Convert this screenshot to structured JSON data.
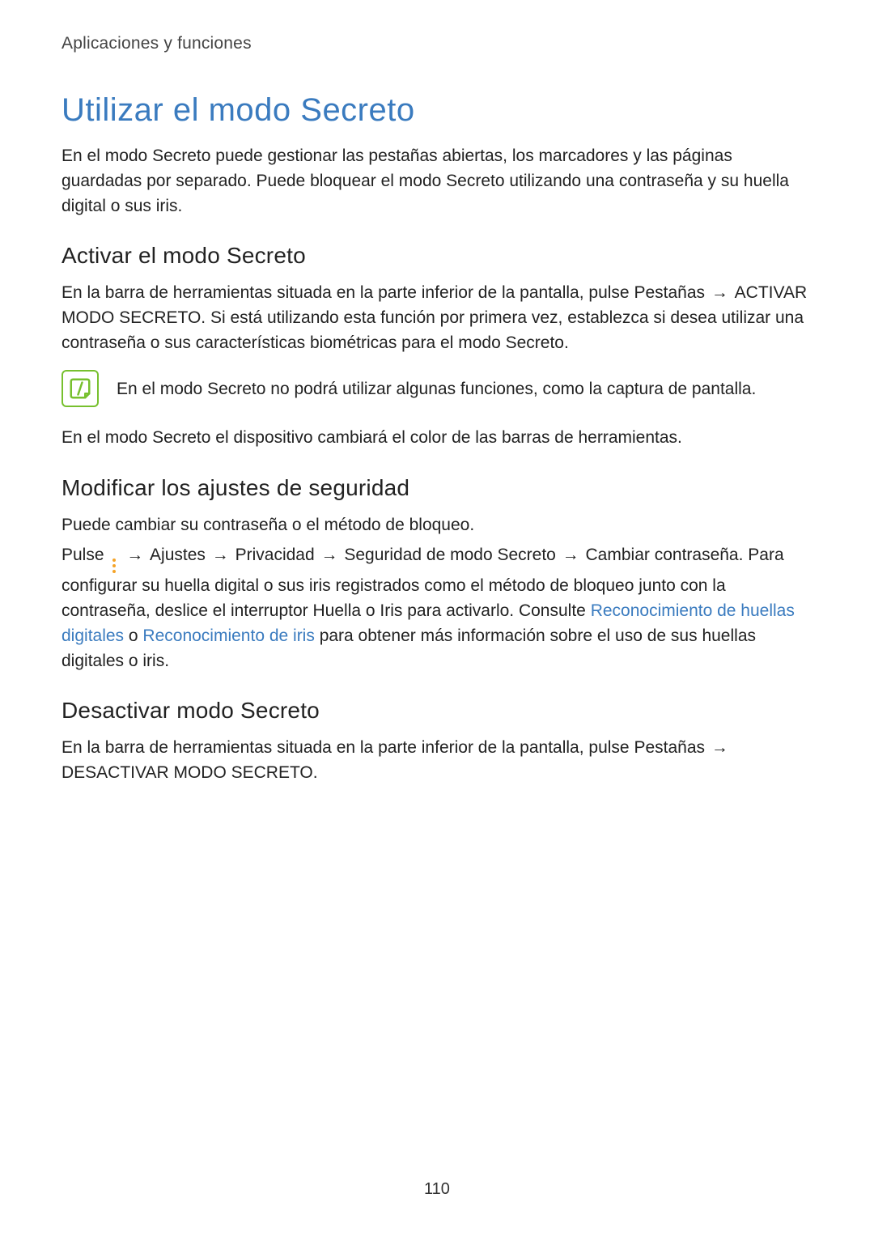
{
  "breadcrumb": "Aplicaciones y funciones",
  "title": "Utilizar el modo Secreto",
  "intro": "En el modo Secreto puede gestionar las pestañas abiertas, los marcadores y las páginas guardadas por separado. Puede bloquear el modo Secreto utilizando una contraseña y su huella digital o sus iris.",
  "sec1": {
    "heading": "Activar el modo Secreto",
    "p1_a": "En la barra de herramientas situada en la parte inferior de la pantalla, pulse ",
    "ui_tabs": "Pestañas",
    "arrow": " → ",
    "ui_activate": "ACTIVAR MODO SECRETO",
    "p1_b": ". Si está utilizando esta función por primera vez, establezca si desea utilizar una contraseña o sus características biométricas para el modo Secreto.",
    "note": "En el modo Secreto no podrá utilizar algunas funciones, como la captura de pantalla.",
    "p2": "En el modo Secreto el dispositivo cambiará el color de las barras de herramientas."
  },
  "sec2": {
    "heading": "Modificar los ajustes de seguridad",
    "p1": "Puede cambiar su contraseña o el método de bloqueo.",
    "p2_a": "Pulse ",
    "arrow": " → ",
    "ui_settings": "Ajustes",
    "ui_privacy": "Privacidad",
    "ui_sec_secret": "Seguridad de modo Secreto",
    "ui_change_pw": "Cambiar contraseña",
    "p2_b": ". Para configurar su huella digital o sus iris registrados como el método de bloqueo junto con la contraseña, deslice el interruptor ",
    "ui_finger_iris": "Huella o Iris",
    "p2_c": " para activarlo. Consulte ",
    "link_fp": "Reconocimiento de huellas digitales",
    "p2_d": " o ",
    "link_iris": "Reconocimiento de iris",
    "p2_e": " para obtener más información sobre el uso de sus huellas digitales o iris."
  },
  "sec3": {
    "heading": "Desactivar modo Secreto",
    "p1_a": "En la barra de herramientas situada en la parte inferior de la pantalla, pulse ",
    "ui_tabs": "Pestañas",
    "arrow": " → ",
    "ui_deactivate": "DESACTIVAR MODO SECRETO",
    "p1_b": "."
  },
  "page_number": "110"
}
